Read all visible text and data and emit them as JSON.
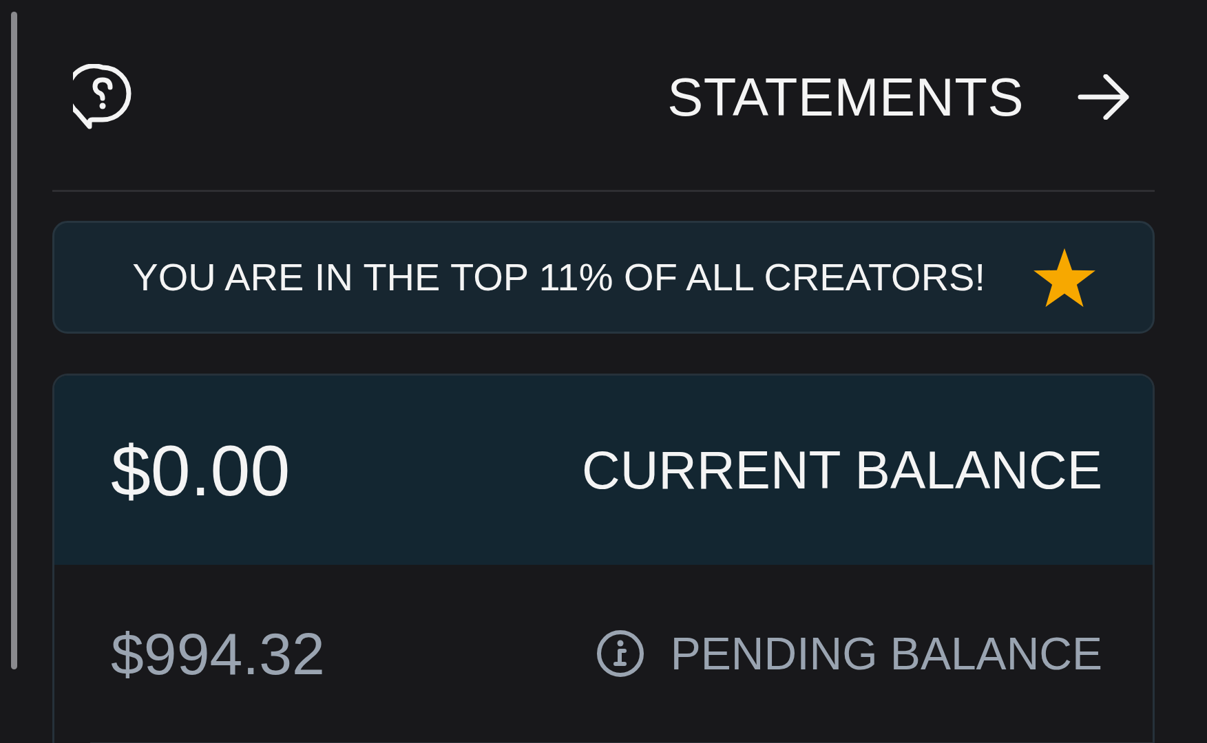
{
  "header": {
    "title": "STATEMENTS"
  },
  "banner": {
    "text": "YOU ARE IN THE TOP 11% OF ALL CREATORS!"
  },
  "balances": [
    {
      "kind": "current",
      "label": "CURRENT BALANCE",
      "amount": "$0.00"
    },
    {
      "kind": "pending",
      "label": "PENDING BALANCE",
      "amount": "$994.32"
    }
  ]
}
